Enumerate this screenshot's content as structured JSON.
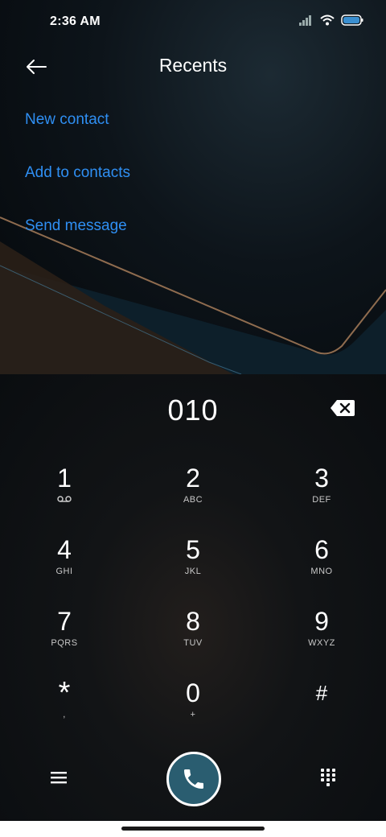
{
  "status_bar": {
    "time": "2:36 AM",
    "icons": [
      "signal-icon",
      "wifi-icon",
      "battery-icon"
    ]
  },
  "header": {
    "title": "Recents",
    "back_icon": "back-arrow-icon"
  },
  "actions": [
    {
      "label": "New contact"
    },
    {
      "label": "Add to contacts"
    },
    {
      "label": "Send message"
    }
  ],
  "dialer": {
    "number": "010",
    "backspace_icon": "backspace-icon"
  },
  "keypad": {
    "keys": [
      {
        "digit": "1",
        "letters": "",
        "sub_icon": "voicemail-icon"
      },
      {
        "digit": "2",
        "letters": "ABC"
      },
      {
        "digit": "3",
        "letters": "DEF"
      },
      {
        "digit": "4",
        "letters": "GHI"
      },
      {
        "digit": "5",
        "letters": "JKL"
      },
      {
        "digit": "6",
        "letters": "MNO"
      },
      {
        "digit": "7",
        "letters": "PQRS"
      },
      {
        "digit": "8",
        "letters": "TUV"
      },
      {
        "digit": "9",
        "letters": "WXYZ"
      },
      {
        "digit": "*",
        "letters": ","
      },
      {
        "digit": "0",
        "letters": "+"
      },
      {
        "digit": "#",
        "letters": ""
      }
    ]
  },
  "bottom_bar": {
    "menu_icon": "menu-icon",
    "call_icon": "phone-icon",
    "keypad_icon": "dialpad-icon"
  },
  "colors": {
    "accent": "#2f8ff3",
    "call_button": "#2a5d70"
  }
}
